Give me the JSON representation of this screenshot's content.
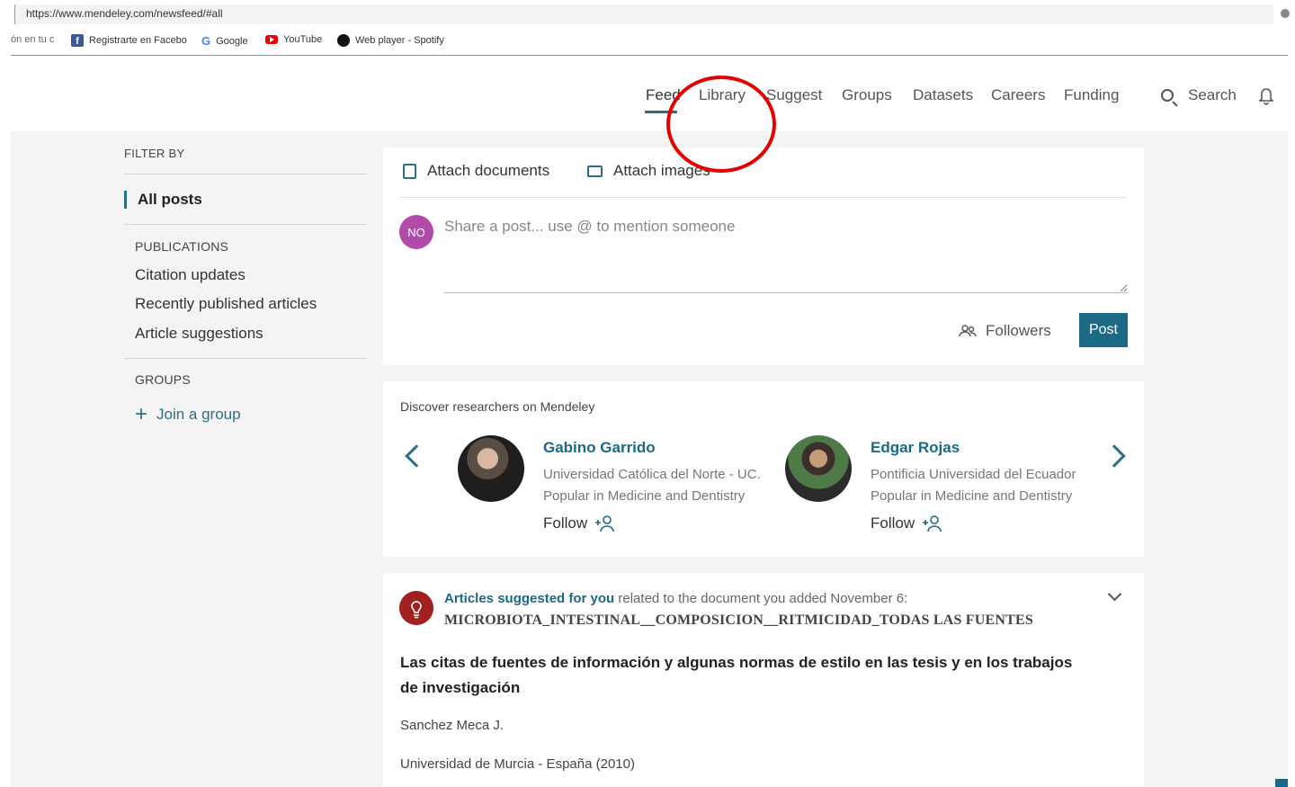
{
  "browser": {
    "url": "https://www.mendeley.com/newsfeed/#all",
    "bookmarks": [
      {
        "label": "ón en tu c",
        "icon": "none"
      },
      {
        "label": "Registrarte en Facebo",
        "icon": "facebook-icon"
      },
      {
        "label": "Google",
        "icon": "google-icon"
      },
      {
        "label": "YouTube",
        "icon": "youtube-icon"
      },
      {
        "label": "Web player - Spotify",
        "icon": "spotify-icon"
      }
    ]
  },
  "nav": {
    "items": [
      "Feed",
      "Library",
      "Suggest",
      "Groups",
      "Datasets",
      "Careers",
      "Funding"
    ],
    "active": "Feed",
    "search_label": "Search"
  },
  "sidebar": {
    "filter_title": "FILTER BY",
    "all_posts": "All posts",
    "publications_label": "PUBLICATIONS",
    "publication_links": [
      "Citation updates",
      "Recently published articles",
      "Article suggestions"
    ],
    "groups_label": "GROUPS",
    "join_group": "Join a group"
  },
  "composer": {
    "attach_documents": "Attach documents",
    "attach_images": "Attach images",
    "avatar_initials": "NO",
    "placeholder": "Share a post... use @ to mention someone",
    "audience": "Followers",
    "post_button": "Post"
  },
  "discover": {
    "title": "Discover researchers on Mendeley",
    "researchers": [
      {
        "name": "Gabino Garrido",
        "institution": "Universidad Católica del Norte - UC.",
        "popularity": "Popular in Medicine and Dentistry",
        "follow": "Follow"
      },
      {
        "name": "Edgar Rojas",
        "institution": "Pontificia Universidad del Ecuador",
        "popularity": "Popular in Medicine and Dentistry",
        "follow": "Follow"
      }
    ]
  },
  "suggestion": {
    "highlight": "Articles suggested for you",
    "rest": " related to the document you added November 6:",
    "document": "MICROBIOTA_INTESTINAL__COMPOSICION__RITMICIDAD_TODAS LAS FUENTES",
    "article_title": "Las citas de fuentes de información y algunas normas de estilo en las tesis y en los trabajos de investigación",
    "author": "Sanchez Meca J.",
    "journal": "Universidad de Murcia - España (2010)"
  },
  "colors": {
    "accent": "#1a6a86",
    "annotation": "#e50000",
    "avatar": "#b14aa8"
  }
}
